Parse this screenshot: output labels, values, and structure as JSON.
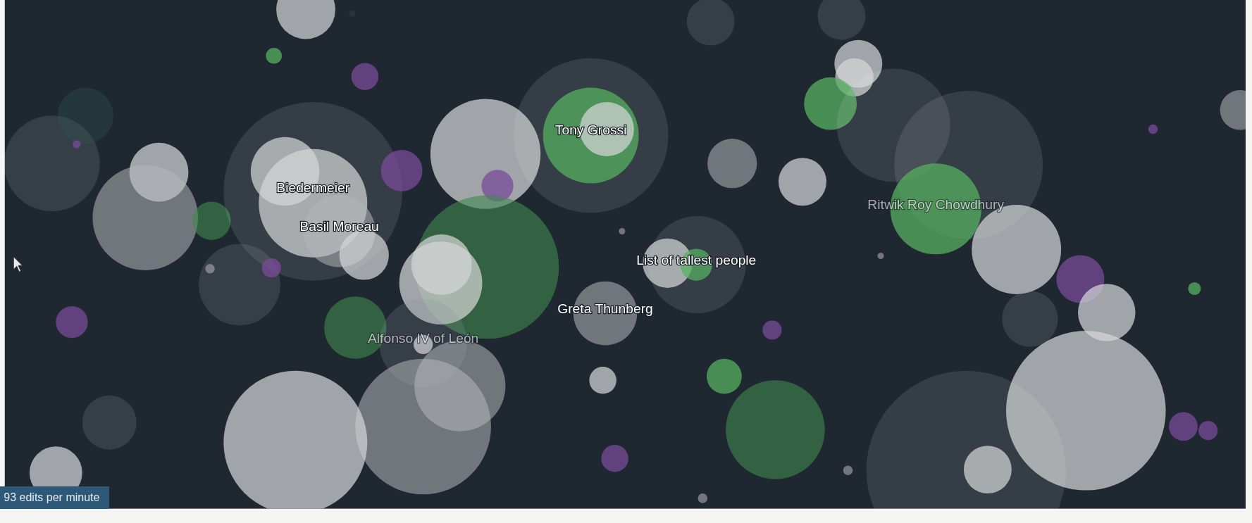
{
  "labels": [
    {
      "text": "Tony Grossi",
      "faded": false
    },
    {
      "text": "Biedermeier",
      "faded": false
    },
    {
      "text": "Ritwik Roy Chowdhury",
      "faded": true
    },
    {
      "text": "Basil Moreau",
      "faded": false
    },
    {
      "text": "List of tallest people",
      "faded": false
    },
    {
      "text": "Greta Thunberg",
      "faded": false
    },
    {
      "text": "Alfonso IV of León",
      "faded": true
    }
  ],
  "edit_rate": "93 edits per minute"
}
